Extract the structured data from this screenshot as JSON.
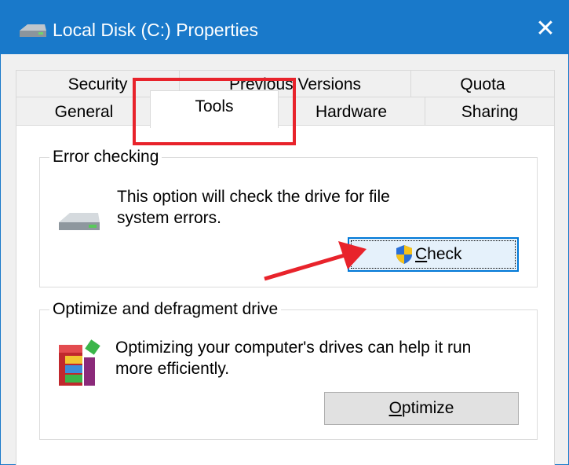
{
  "window": {
    "title": "Local Disk (C:) Properties",
    "close_glyph": "✕"
  },
  "tabs": {
    "row1": [
      "Security",
      "Previous Versions",
      "Quota"
    ],
    "row2": [
      "General",
      "Tools",
      "Hardware",
      "Sharing"
    ],
    "active": "Tools"
  },
  "error_checking": {
    "title": "Error checking",
    "description_line1": "This option will check the drive for file",
    "description_line2": "system errors.",
    "button_label": "Check",
    "button_mnemonic": "C",
    "button_rest": "heck",
    "icon": "drive-icon",
    "button_icon": "uac-shield-icon"
  },
  "optimize": {
    "title": "Optimize and defragment drive",
    "description_line1": "Optimizing your computer's drives can help it run",
    "description_line2": "more efficiently.",
    "button_label": "Optimize",
    "button_mnemonic": "O",
    "button_rest": "ptimize",
    "icon": "defrag-icon"
  },
  "annotation": {
    "highlight_color": "#e8232b",
    "arrow_color": "#e8232b"
  },
  "colors": {
    "titlebar": "#1979ca",
    "focus_border": "#0078d7"
  }
}
